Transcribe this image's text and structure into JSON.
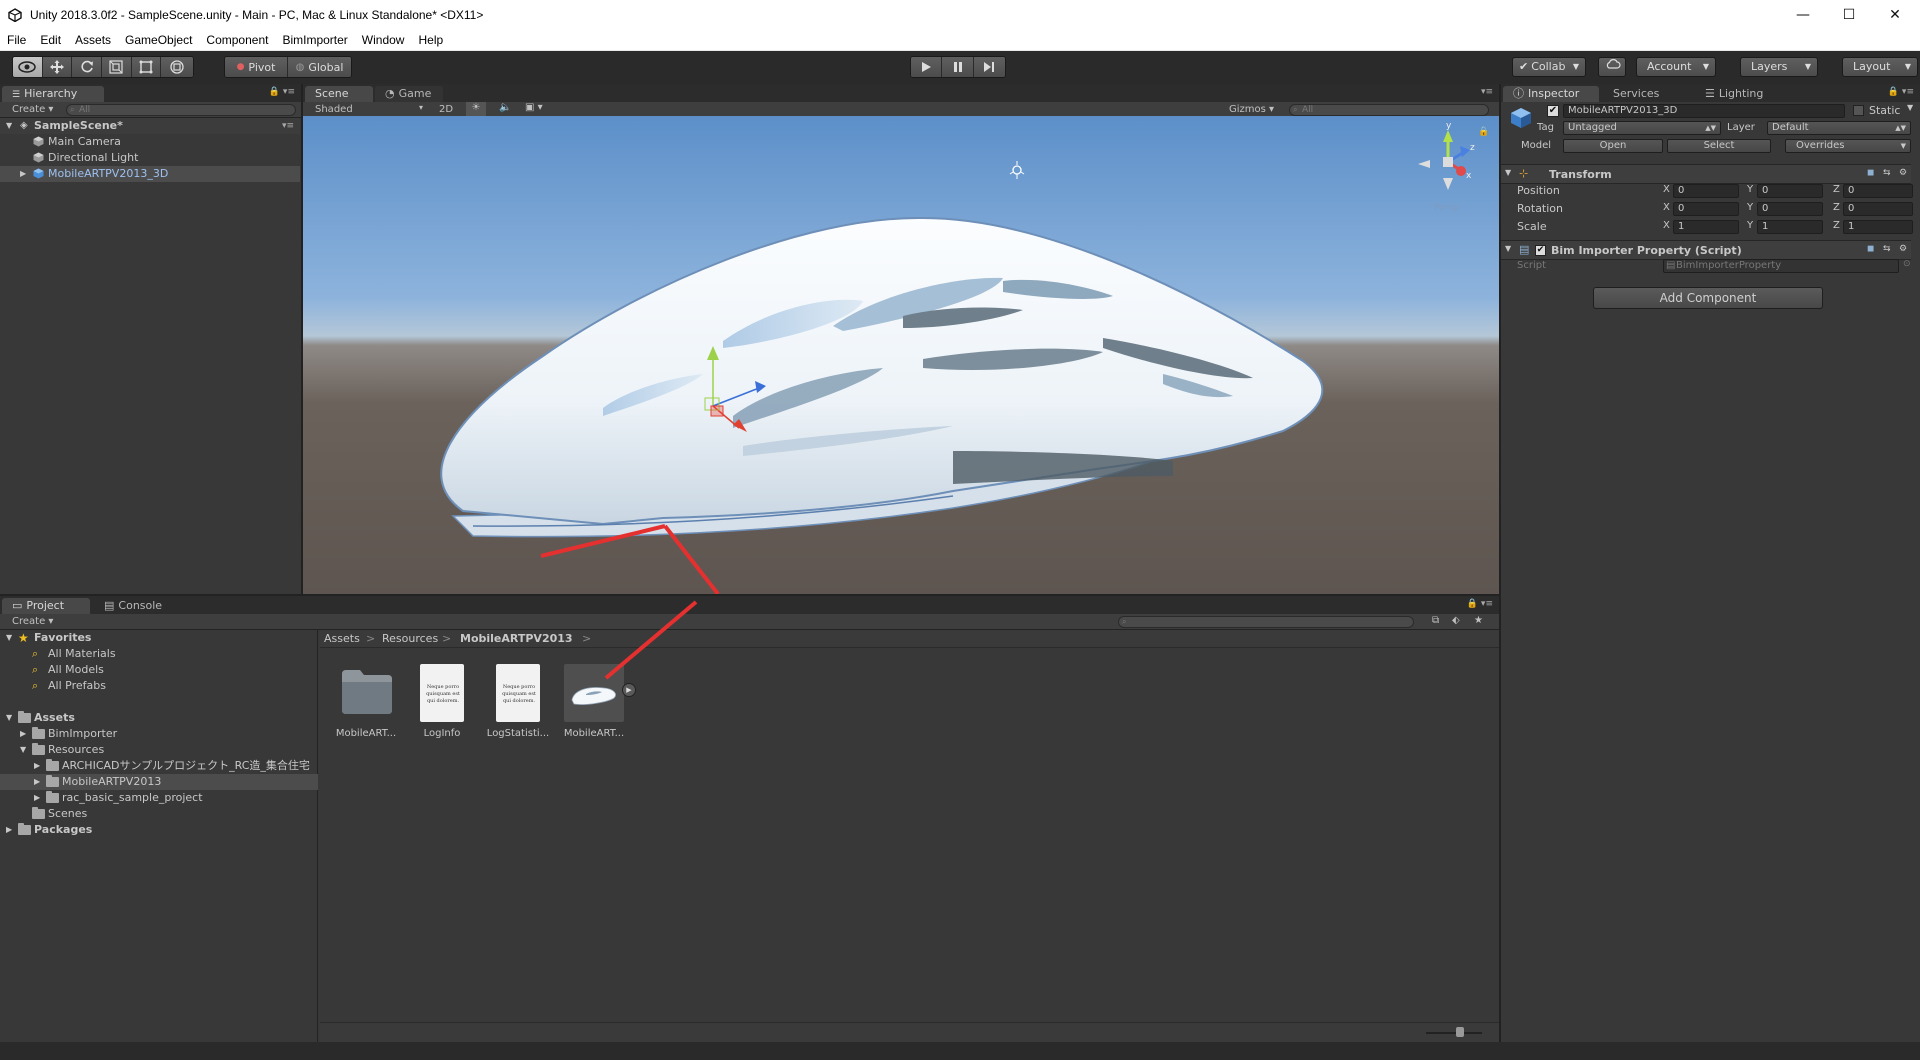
{
  "window": {
    "title": "Unity 2018.3.0f2 - SampleScene.unity - Main - PC, Mac & Linux Standalone* <DX11>",
    "minimize": "—",
    "maximize": "☐",
    "close": "✕"
  },
  "menu": [
    "File",
    "Edit",
    "Assets",
    "GameObject",
    "Component",
    "BimImporter",
    "Window",
    "Help"
  ],
  "toolbar": {
    "pivot_label": "Pivot",
    "global_label": "Global",
    "collab_label": "Collab",
    "account_label": "Account",
    "layers_label": "Layers",
    "layout_label": "Layout"
  },
  "hierarchy": {
    "tab": "Hierarchy",
    "create_label": "Create",
    "search_placeholder": "All",
    "scene_name": "SampleScene*",
    "items": [
      "Main Camera",
      "Directional Light",
      "MobileARTPV2013_3D"
    ]
  },
  "scene_view": {
    "tabs": [
      "Scene",
      "Game"
    ],
    "shading_mode": "Shaded",
    "mode_2d": "2D",
    "gizmos_label": "Gizmos",
    "search_placeholder": "All",
    "gizmo_axis_labels": {
      "y": "y",
      "z": "z",
      "x": "x"
    },
    "persp_label": "Persp"
  },
  "inspector": {
    "tabs": [
      "Inspector",
      "Services",
      "Lighting"
    ],
    "object_name": "MobileARTPV2013_3D",
    "static_label": "Static",
    "tag_label": "Tag",
    "tag_value": "Untagged",
    "layer_label": "Layer",
    "layer_value": "Default",
    "model_label": "Model",
    "model_buttons": [
      "Open",
      "Select",
      "Overrides"
    ],
    "transform": {
      "title": "Transform",
      "rows": [
        {
          "label": "Position",
          "x": "0",
          "y": "0",
          "z": "0"
        },
        {
          "label": "Rotation",
          "x": "0",
          "y": "0",
          "z": "0"
        },
        {
          "label": "Scale",
          "x": "1",
          "y": "1",
          "z": "1"
        }
      ],
      "axis_letters": [
        "X",
        "Y",
        "Z"
      ]
    },
    "script_component": {
      "title": "Bim Importer Property (Script)",
      "script_label": "Script",
      "script_value": "BimImporterProperty"
    },
    "add_component_label": "Add Component"
  },
  "project": {
    "tabs": [
      "Project",
      "Console"
    ],
    "create_label": "Create",
    "favorites_label": "Favorites",
    "favorites": [
      "All Materials",
      "All Models",
      "All Prefabs"
    ],
    "assets_label": "Assets",
    "tree": [
      {
        "label": "BimImporter",
        "indent": 1,
        "expander": "▶"
      },
      {
        "label": "Resources",
        "indent": 1,
        "expander": "▼"
      },
      {
        "label": "ARCHICADサンプルプロジェクト_RC造_集合住宅",
        "indent": 2,
        "expander": "▶"
      },
      {
        "label": "MobileARTPV2013",
        "indent": 2,
        "expander": "▶",
        "selected": true
      },
      {
        "label": "rac_basic_sample_project",
        "indent": 2,
        "expander": "▶"
      },
      {
        "label": "Scenes",
        "indent": 1,
        "expander": ""
      }
    ],
    "packages_label": "Packages",
    "breadcrumb": [
      "Assets",
      "Resources",
      "MobileARTPV2013"
    ],
    "breadcrumb_sep": ">",
    "assets": [
      {
        "label": "MobileART...",
        "kind": "folder"
      },
      {
        "label": "LogInfo",
        "kind": "text"
      },
      {
        "label": "LogStatisti...",
        "kind": "text"
      },
      {
        "label": "MobileART...",
        "kind": "model"
      }
    ],
    "doc_preview_text": "Neque porro quisquam est qui dolorem."
  },
  "colors": {
    "selection_blue": "#9ec1f0",
    "annotation_arrow": "#e53030",
    "window_bg": "#383838"
  }
}
